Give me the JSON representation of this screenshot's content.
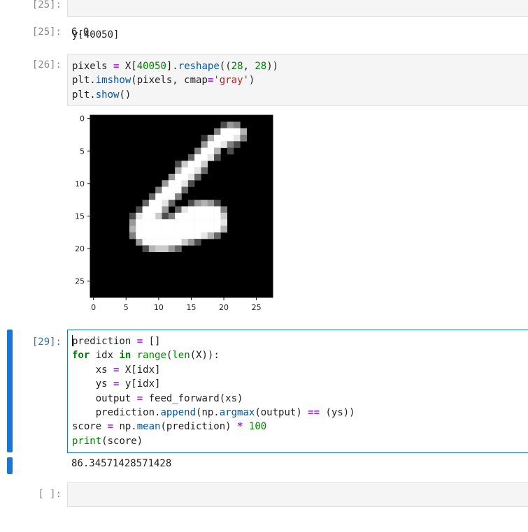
{
  "cells": [
    {
      "id": "cell-25-in",
      "prompt": "[25]:",
      "code": "y[40050]"
    },
    {
      "id": "cell-25-out",
      "prompt": "[25]:",
      "output": "6.0"
    },
    {
      "id": "cell-26-in",
      "prompt": "[26]:",
      "lines": [
        "pixels = X[40050].reshape((28, 28))",
        "plt.imshow(pixels, cmap='gray')",
        "plt.show()"
      ]
    },
    {
      "id": "cell-29-in",
      "prompt": "[29]:",
      "lines": [
        "prediction = []",
        "for idx in range(len(X)):",
        "    xs = X[idx]",
        "    ys = y[idx]",
        "    output = feed_forward(xs)",
        "    prediction.append(np.argmax(output) == (ys))",
        "score = np.mean(prediction) * 100",
        "print(score)"
      ]
    },
    {
      "id": "cell-29-out",
      "output": "86.34571428571428"
    },
    {
      "id": "cell-empty",
      "prompt": "[ ]:",
      "code": ""
    }
  ],
  "chart_data": {
    "type": "heatmap",
    "colormap": "gray",
    "rows": 28,
    "cols": 28,
    "x_ticks": [
      "0",
      "5",
      "10",
      "15",
      "20",
      "25"
    ],
    "y_ticks": [
      "0",
      "5",
      "10",
      "15",
      "20",
      "25"
    ],
    "tick_values": [
      0,
      5,
      10,
      15,
      20,
      25
    ],
    "pixels": [
      {
        "r": 1,
        "c": 20,
        "v": 0.3
      },
      {
        "r": 1,
        "c": 21,
        "v": 0.6
      },
      {
        "r": 1,
        "c": 22,
        "v": 0.5
      },
      {
        "r": 2,
        "c": 19,
        "v": 0.5
      },
      {
        "r": 2,
        "c": 20,
        "v": 1
      },
      {
        "r": 2,
        "c": 21,
        "v": 1
      },
      {
        "r": 2,
        "c": 22,
        "v": 1
      },
      {
        "r": 2,
        "c": 23,
        "v": 0.7
      },
      {
        "r": 3,
        "c": 17,
        "v": 0.2
      },
      {
        "r": 3,
        "c": 18,
        "v": 0.7
      },
      {
        "r": 3,
        "c": 19,
        "v": 1
      },
      {
        "r": 3,
        "c": 20,
        "v": 1
      },
      {
        "r": 3,
        "c": 21,
        "v": 1
      },
      {
        "r": 3,
        "c": 22,
        "v": 0.9
      },
      {
        "r": 3,
        "c": 23,
        "v": 0.5
      },
      {
        "r": 4,
        "c": 17,
        "v": 0.6
      },
      {
        "r": 4,
        "c": 18,
        "v": 1
      },
      {
        "r": 4,
        "c": 19,
        "v": 1
      },
      {
        "r": 4,
        "c": 20,
        "v": 0.9
      },
      {
        "r": 4,
        "c": 21,
        "v": 0.5
      },
      {
        "r": 4,
        "c": 22,
        "v": 0.3
      },
      {
        "r": 5,
        "c": 16,
        "v": 0.5
      },
      {
        "r": 5,
        "c": 17,
        "v": 1
      },
      {
        "r": 5,
        "c": 18,
        "v": 1
      },
      {
        "r": 5,
        "c": 19,
        "v": 0.7
      },
      {
        "r": 5,
        "c": 21,
        "v": 0.3
      },
      {
        "r": 6,
        "c": 15,
        "v": 0.4
      },
      {
        "r": 6,
        "c": 16,
        "v": 1
      },
      {
        "r": 6,
        "c": 17,
        "v": 1
      },
      {
        "r": 6,
        "c": 18,
        "v": 0.9
      },
      {
        "r": 6,
        "c": 19,
        "v": 0.3
      },
      {
        "r": 7,
        "c": 13,
        "v": 0.3
      },
      {
        "r": 7,
        "c": 14,
        "v": 0.8
      },
      {
        "r": 7,
        "c": 15,
        "v": 1
      },
      {
        "r": 7,
        "c": 16,
        "v": 1
      },
      {
        "r": 7,
        "c": 17,
        "v": 0.8
      },
      {
        "r": 8,
        "c": 13,
        "v": 0.7
      },
      {
        "r": 8,
        "c": 14,
        "v": 1
      },
      {
        "r": 8,
        "c": 15,
        "v": 1
      },
      {
        "r": 8,
        "c": 16,
        "v": 0.9
      },
      {
        "r": 8,
        "c": 17,
        "v": 0.4
      },
      {
        "r": 9,
        "c": 12,
        "v": 0.6
      },
      {
        "r": 9,
        "c": 13,
        "v": 1
      },
      {
        "r": 9,
        "c": 14,
        "v": 1
      },
      {
        "r": 9,
        "c": 15,
        "v": 0.9
      },
      {
        "r": 9,
        "c": 16,
        "v": 0.4
      },
      {
        "r": 10,
        "c": 11,
        "v": 0.6
      },
      {
        "r": 10,
        "c": 12,
        "v": 1
      },
      {
        "r": 10,
        "c": 13,
        "v": 1
      },
      {
        "r": 10,
        "c": 14,
        "v": 0.9
      },
      {
        "r": 10,
        "c": 15,
        "v": 0.3
      },
      {
        "r": 11,
        "c": 10,
        "v": 0.5
      },
      {
        "r": 11,
        "c": 11,
        "v": 1
      },
      {
        "r": 11,
        "c": 12,
        "v": 1
      },
      {
        "r": 11,
        "c": 13,
        "v": 1
      },
      {
        "r": 11,
        "c": 14,
        "v": 0.4
      },
      {
        "r": 12,
        "c": 9,
        "v": 0.4
      },
      {
        "r": 12,
        "c": 10,
        "v": 1
      },
      {
        "r": 12,
        "c": 11,
        "v": 1
      },
      {
        "r": 12,
        "c": 12,
        "v": 1
      },
      {
        "r": 12,
        "c": 13,
        "v": 0.5
      },
      {
        "r": 13,
        "c": 8,
        "v": 0.4
      },
      {
        "r": 13,
        "c": 9,
        "v": 1
      },
      {
        "r": 13,
        "c": 10,
        "v": 1
      },
      {
        "r": 13,
        "c": 11,
        "v": 0.9
      },
      {
        "r": 13,
        "c": 12,
        "v": 0.4
      },
      {
        "r": 13,
        "c": 15,
        "v": 0.3
      },
      {
        "r": 13,
        "c": 16,
        "v": 0.6
      },
      {
        "r": 13,
        "c": 17,
        "v": 0.7
      },
      {
        "r": 13,
        "c": 18,
        "v": 0.6
      },
      {
        "r": 13,
        "c": 19,
        "v": 0.3
      },
      {
        "r": 14,
        "c": 7,
        "v": 0.3
      },
      {
        "r": 14,
        "c": 8,
        "v": 1
      },
      {
        "r": 14,
        "c": 9,
        "v": 1
      },
      {
        "r": 14,
        "c": 10,
        "v": 1
      },
      {
        "r": 14,
        "c": 11,
        "v": 0.6
      },
      {
        "r": 14,
        "c": 13,
        "v": 0.4
      },
      {
        "r": 14,
        "c": 14,
        "v": 0.9
      },
      {
        "r": 14,
        "c": 15,
        "v": 1
      },
      {
        "r": 14,
        "c": 16,
        "v": 1
      },
      {
        "r": 14,
        "c": 17,
        "v": 1
      },
      {
        "r": 14,
        "c": 18,
        "v": 1
      },
      {
        "r": 14,
        "c": 19,
        "v": 1
      },
      {
        "r": 14,
        "c": 20,
        "v": 0.5
      },
      {
        "r": 15,
        "c": 6,
        "v": 0.3
      },
      {
        "r": 15,
        "c": 7,
        "v": 0.9
      },
      {
        "r": 15,
        "c": 8,
        "v": 1
      },
      {
        "r": 15,
        "c": 9,
        "v": 1
      },
      {
        "r": 15,
        "c": 10,
        "v": 0.8
      },
      {
        "r": 15,
        "c": 11,
        "v": 0.3
      },
      {
        "r": 15,
        "c": 12,
        "v": 0.5
      },
      {
        "r": 15,
        "c": 13,
        "v": 1
      },
      {
        "r": 15,
        "c": 14,
        "v": 1
      },
      {
        "r": 15,
        "c": 15,
        "v": 1
      },
      {
        "r": 15,
        "c": 16,
        "v": 1
      },
      {
        "r": 15,
        "c": 17,
        "v": 1
      },
      {
        "r": 15,
        "c": 18,
        "v": 1
      },
      {
        "r": 15,
        "c": 19,
        "v": 1
      },
      {
        "r": 15,
        "c": 20,
        "v": 0.8
      },
      {
        "r": 16,
        "c": 6,
        "v": 0.6
      },
      {
        "r": 16,
        "c": 7,
        "v": 1
      },
      {
        "r": 16,
        "c": 8,
        "v": 1
      },
      {
        "r": 16,
        "c": 9,
        "v": 1
      },
      {
        "r": 16,
        "c": 10,
        "v": 1
      },
      {
        "r": 16,
        "c": 11,
        "v": 1
      },
      {
        "r": 16,
        "c": 12,
        "v": 1
      },
      {
        "r": 16,
        "c": 13,
        "v": 1
      },
      {
        "r": 16,
        "c": 14,
        "v": 1
      },
      {
        "r": 16,
        "c": 15,
        "v": 1
      },
      {
        "r": 16,
        "c": 16,
        "v": 1
      },
      {
        "r": 16,
        "c": 17,
        "v": 1
      },
      {
        "r": 16,
        "c": 18,
        "v": 1
      },
      {
        "r": 16,
        "c": 19,
        "v": 1
      },
      {
        "r": 16,
        "c": 20,
        "v": 0.9
      },
      {
        "r": 17,
        "c": 6,
        "v": 0.7
      },
      {
        "r": 17,
        "c": 7,
        "v": 1
      },
      {
        "r": 17,
        "c": 8,
        "v": 1
      },
      {
        "r": 17,
        "c": 9,
        "v": 1
      },
      {
        "r": 17,
        "c": 10,
        "v": 1
      },
      {
        "r": 17,
        "c": 11,
        "v": 1
      },
      {
        "r": 17,
        "c": 12,
        "v": 1
      },
      {
        "r": 17,
        "c": 13,
        "v": 1
      },
      {
        "r": 17,
        "c": 14,
        "v": 1
      },
      {
        "r": 17,
        "c": 15,
        "v": 1
      },
      {
        "r": 17,
        "c": 16,
        "v": 1
      },
      {
        "r": 17,
        "c": 17,
        "v": 1
      },
      {
        "r": 17,
        "c": 18,
        "v": 1
      },
      {
        "r": 17,
        "c": 19,
        "v": 1
      },
      {
        "r": 17,
        "c": 20,
        "v": 0.7
      },
      {
        "r": 18,
        "c": 6,
        "v": 0.5
      },
      {
        "r": 18,
        "c": 7,
        "v": 1
      },
      {
        "r": 18,
        "c": 8,
        "v": 1
      },
      {
        "r": 18,
        "c": 9,
        "v": 1
      },
      {
        "r": 18,
        "c": 10,
        "v": 1
      },
      {
        "r": 18,
        "c": 11,
        "v": 1
      },
      {
        "r": 18,
        "c": 12,
        "v": 1
      },
      {
        "r": 18,
        "c": 13,
        "v": 1
      },
      {
        "r": 18,
        "c": 14,
        "v": 1
      },
      {
        "r": 18,
        "c": 15,
        "v": 1
      },
      {
        "r": 18,
        "c": 16,
        "v": 1
      },
      {
        "r": 18,
        "c": 17,
        "v": 0.9
      },
      {
        "r": 18,
        "c": 18,
        "v": 0.7
      },
      {
        "r": 18,
        "c": 19,
        "v": 0.4
      },
      {
        "r": 19,
        "c": 7,
        "v": 0.6
      },
      {
        "r": 19,
        "c": 8,
        "v": 1
      },
      {
        "r": 19,
        "c": 9,
        "v": 1
      },
      {
        "r": 19,
        "c": 10,
        "v": 1
      },
      {
        "r": 19,
        "c": 11,
        "v": 1
      },
      {
        "r": 19,
        "c": 12,
        "v": 1
      },
      {
        "r": 19,
        "c": 13,
        "v": 1
      },
      {
        "r": 19,
        "c": 14,
        "v": 0.8
      },
      {
        "r": 19,
        "c": 15,
        "v": 0.6
      },
      {
        "r": 19,
        "c": 16,
        "v": 0.3
      },
      {
        "r": 20,
        "c": 8,
        "v": 0.3
      },
      {
        "r": 20,
        "c": 9,
        "v": 0.7
      },
      {
        "r": 20,
        "c": 10,
        "v": 0.8
      },
      {
        "r": 20,
        "c": 11,
        "v": 0.8
      },
      {
        "r": 20,
        "c": 12,
        "v": 0.6
      },
      {
        "r": 20,
        "c": 13,
        "v": 0.4
      }
    ]
  }
}
